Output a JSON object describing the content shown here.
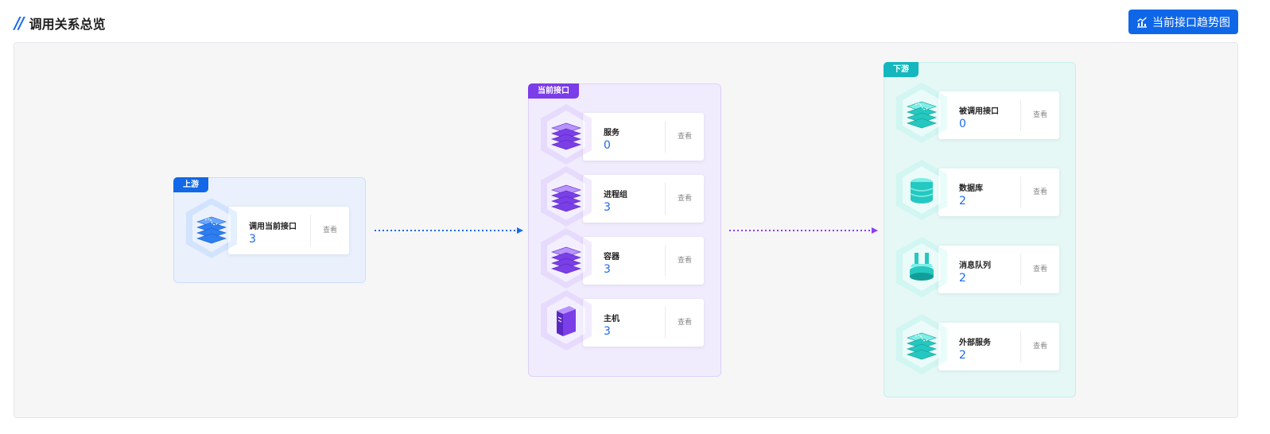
{
  "header": {
    "title": "调用关系总览"
  },
  "toolbar": {
    "trend_label": "当前接口趋势图",
    "trend_icon": "chart-trend-icon"
  },
  "colors": {
    "upstream": "#1268e6",
    "current": "#7b3ce9",
    "downstream": "#14b7bd",
    "count": "#1d6bea"
  },
  "upstream": {
    "label": "上游",
    "items": [
      {
        "name": "调用当前接口",
        "count": "3",
        "view": "查看",
        "icon": "interface-stack-icon"
      }
    ]
  },
  "current": {
    "label": "当前接口",
    "items": [
      {
        "name": "服务",
        "count": "0",
        "view": "查看",
        "icon": "server-stack-icon"
      },
      {
        "name": "进程组",
        "count": "3",
        "view": "查看",
        "icon": "process-group-icon"
      },
      {
        "name": "容器",
        "count": "3",
        "view": "查看",
        "icon": "container-icon"
      },
      {
        "name": "主机",
        "count": "3",
        "view": "查看",
        "icon": "host-icon"
      }
    ]
  },
  "downstream": {
    "label": "下游",
    "items": [
      {
        "name": "被调用接口",
        "count": "0",
        "view": "查看",
        "icon": "called-interface-icon"
      },
      {
        "name": "数据库",
        "count": "2",
        "view": "查看",
        "icon": "database-icon"
      },
      {
        "name": "消息队列",
        "count": "2",
        "view": "查看",
        "icon": "message-queue-icon"
      },
      {
        "name": "外部服务",
        "count": "2",
        "view": "查看",
        "icon": "external-service-icon"
      }
    ]
  }
}
